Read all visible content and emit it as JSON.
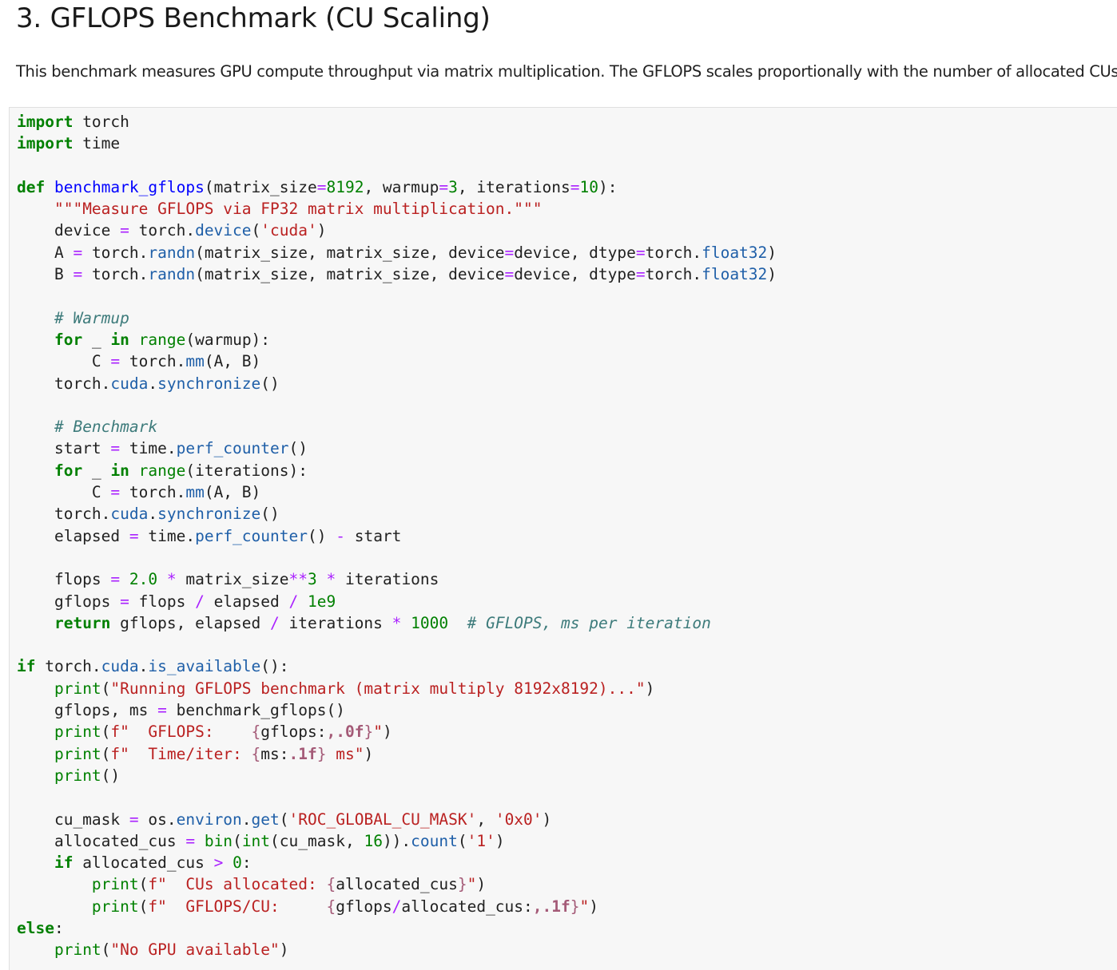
{
  "section": {
    "title": "3. GFLOPS Benchmark (CU Scaling)",
    "description": "This benchmark measures GPU compute throughput via matrix multiplication. The GFLOPS scales proportionally with the number of allocated CUs."
  },
  "code_cell": {
    "language": "python",
    "lines": [
      "import torch",
      "import time",
      "",
      "def benchmark_gflops(matrix_size=8192, warmup=3, iterations=10):",
      "    \"\"\"Measure GFLOPS via FP32 matrix multiplication.\"\"\"",
      "    device = torch.device('cuda')",
      "    A = torch.randn(matrix_size, matrix_size, device=device, dtype=torch.float32)",
      "    B = torch.randn(matrix_size, matrix_size, device=device, dtype=torch.float32)",
      "",
      "    # Warmup",
      "    for _ in range(warmup):",
      "        C = torch.mm(A, B)",
      "    torch.cuda.synchronize()",
      "",
      "    # Benchmark",
      "    start = time.perf_counter()",
      "    for _ in range(iterations):",
      "        C = torch.mm(A, B)",
      "    torch.cuda.synchronize()",
      "    elapsed = time.perf_counter() - start",
      "",
      "    flops = 2.0 * matrix_size**3 * iterations",
      "    gflops = flops / elapsed / 1e9",
      "    return gflops, elapsed / iterations * 1000  # GFLOPS, ms per iteration",
      "",
      "if torch.cuda.is_available():",
      "    print(\"Running GFLOPS benchmark (matrix multiply 8192x8192)...\")",
      "    gflops, ms = benchmark_gflops()",
      "    print(f\"  GFLOPS:    {gflops:,.0f}\")",
      "    print(f\"  Time/iter: {ms:.1f} ms\")",
      "    print()",
      "",
      "    cu_mask = os.environ.get('ROC_GLOBAL_CU_MASK', '0x0')",
      "    allocated_cus = bin(int(cu_mask, 16)).count('1')",
      "    if allocated_cus > 0:",
      "        print(f\"  CUs allocated: {allocated_cus}\")",
      "        print(f\"  GFLOPS/CU:     {gflops/allocated_cus:,.1f}\")",
      "else:",
      "    print(\"No GPU available\")"
    ]
  }
}
